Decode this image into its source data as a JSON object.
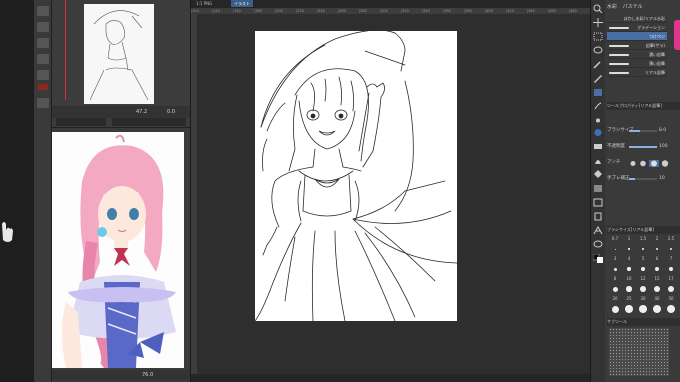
{
  "navigator": {
    "zoom": "47.2",
    "angle": "0.0"
  },
  "reference": {
    "zoom": "76.0"
  },
  "canvas": {
    "tabs": [
      "1:1 PNG",
      "イラスト"
    ],
    "ruler_ticks": [
      "120",
      "140",
      "160",
      "180",
      "200",
      "220",
      "240",
      "260",
      "280",
      "300",
      "320",
      "340",
      "360",
      "380",
      "400",
      "420",
      "440",
      "460",
      "480"
    ]
  },
  "brush_panel": {
    "tabs": [
      "水彩",
      "パステル"
    ],
    "items": [
      "ぼかし水彩/リアル水彩",
      "グラデーション",
      "つけペン",
      "鉛筆(ザラ)",
      "濃い鉛筆",
      "薄い鉛筆",
      "リアル鉛筆"
    ]
  },
  "tool_property": {
    "header": "ツールプロパティ[リアル鉛筆]",
    "rows": [
      {
        "label": "ブラシサイズ",
        "value": "8.0",
        "fill": 0.4
      },
      {
        "label": "不透明度",
        "value": "100",
        "fill": 1.0
      },
      {
        "label": "アンチ",
        "value": "",
        "fill": 0.0
      },
      {
        "label": "手ブレ補正",
        "value": "10",
        "fill": 0.2
      }
    ]
  },
  "brush_size": {
    "header": "ブラシサイズ[リアル鉛筆]",
    "numbers": [
      "0.7",
      "1",
      "1.5",
      "2",
      "2.5",
      "3",
      "4",
      "5",
      "6",
      "7",
      "8",
      "10",
      "12",
      "15",
      "17",
      "20",
      "25",
      "30",
      "40",
      "50"
    ]
  },
  "subtool": {
    "header": "サブツール"
  },
  "colors": {
    "accent": "#4a6fa5",
    "pink": "#e0368f",
    "canvas_bg": "#2e2e2e"
  }
}
